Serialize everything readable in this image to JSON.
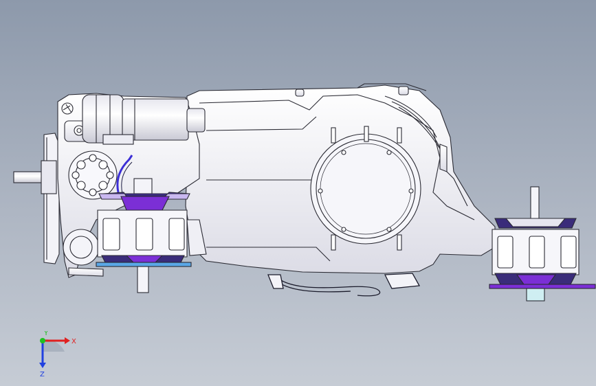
{
  "viewport": {
    "background_top": "#8d99ab",
    "background_bottom": "#c6ccd5"
  },
  "model": {
    "part_color": "#f1f1f5",
    "edge_color": "#2a2a33",
    "mount_accent": "#7b2fd6",
    "hose_color": "#3c2fd6"
  },
  "triad": {
    "x_label": "X",
    "y_label": "Y",
    "z_label": "Z",
    "x_color": "#e02020",
    "y_color": "#20c020",
    "z_color": "#2040e0"
  }
}
